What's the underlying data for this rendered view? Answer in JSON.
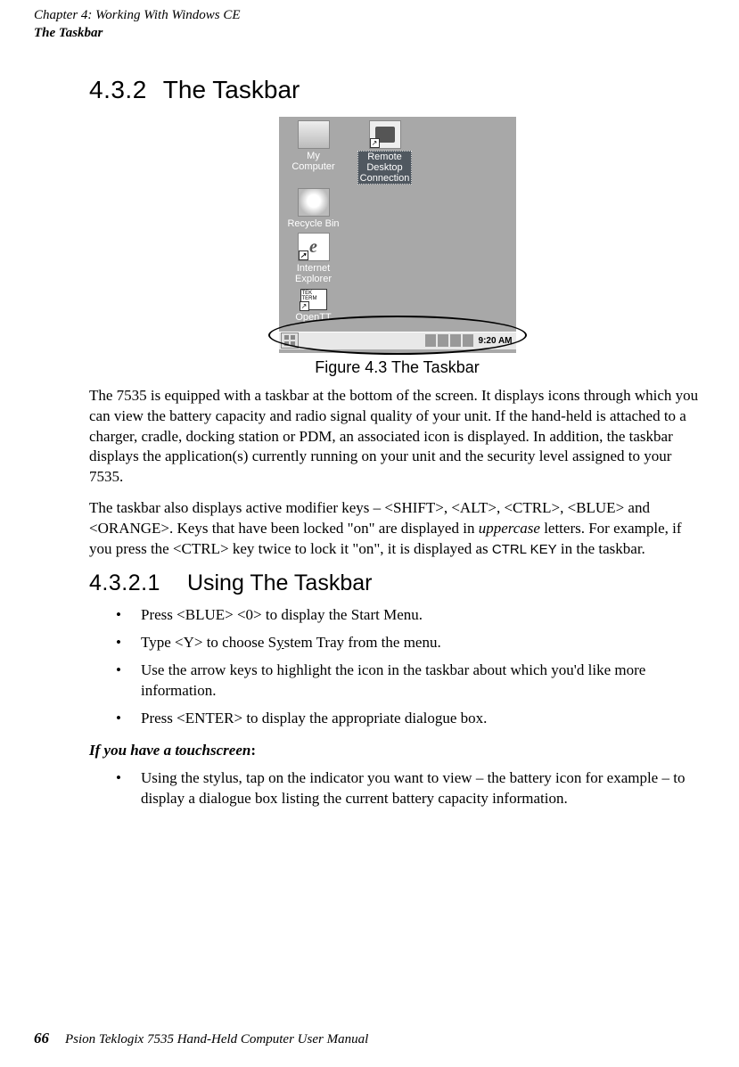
{
  "header": {
    "chapter_line": "Chapter 4: Working With Windows CE",
    "section_line": "The Taskbar"
  },
  "section_432": {
    "number": "4.3.2",
    "title": "The Taskbar"
  },
  "wince_desktop": {
    "my_computer": "My\nComputer",
    "remote_desktop": "Remote\nDesktop\nConnection",
    "recycle_bin": "Recycle Bin",
    "internet_explorer": "Internet\nExplorer",
    "opentt": "OpenTT",
    "opentt_badge": "TEK\nTERM",
    "taskbar_time": "9:20 AM"
  },
  "figure_caption": "Figure 4.3 The Taskbar",
  "para1": "The 7535 is equipped with a taskbar at the bottom of the screen. It displays icons through which you can view the battery capacity and radio signal quality of your unit. If the hand-held is attached to a charger, cradle, docking station or PDM, an associated icon is displayed. In addition, the taskbar displays the application(s) currently running on your unit and the security level assigned to your 7535.",
  "para2_a": "The taskbar also displays active modifier keys – <SHIFT>, <ALT>, <CTRL>, <BLUE> and <ORANGE>. Keys that have been locked \"on\" are displayed in ",
  "para2_b_italic": "uppercase",
  "para2_c": " letters. For example, if you press the <CTRL> key twice to lock it \"on\", it is displayed as ",
  "para2_ctrl": "CTRL KEY",
  "para2_d": " in the taskbar.",
  "section_4321": {
    "number": "4.3.2.1",
    "title": "Using The Taskbar"
  },
  "bullets_a": {
    "b1_a": "Press <BLUE> <0> to display the ",
    "b1_b_bold": "Start Menu",
    "b1_c": ".",
    "b2_a": "Type <Y> to choose ",
    "b2_mono_pre": "S",
    "b2_mono_under": "y",
    "b2_mono_post": "stem Tray",
    "b2_c": " from the menu.",
    "b3": "Use the arrow keys to highlight the icon in the taskbar about which you'd like more information.",
    "b4": "Press <ENTER> to display the appropriate dialogue box."
  },
  "touchscreen_label": "If you have a touchscreen",
  "touchscreen_colon": ":",
  "bullets_b": {
    "b1": "Using the stylus, tap on the indicator you want to view – the battery icon for example – to display a dialogue box listing the current battery capacity information."
  },
  "footer": {
    "page_number": "66",
    "book_title": "Psion Teklogix 7535 Hand-Held Computer User Manual"
  }
}
